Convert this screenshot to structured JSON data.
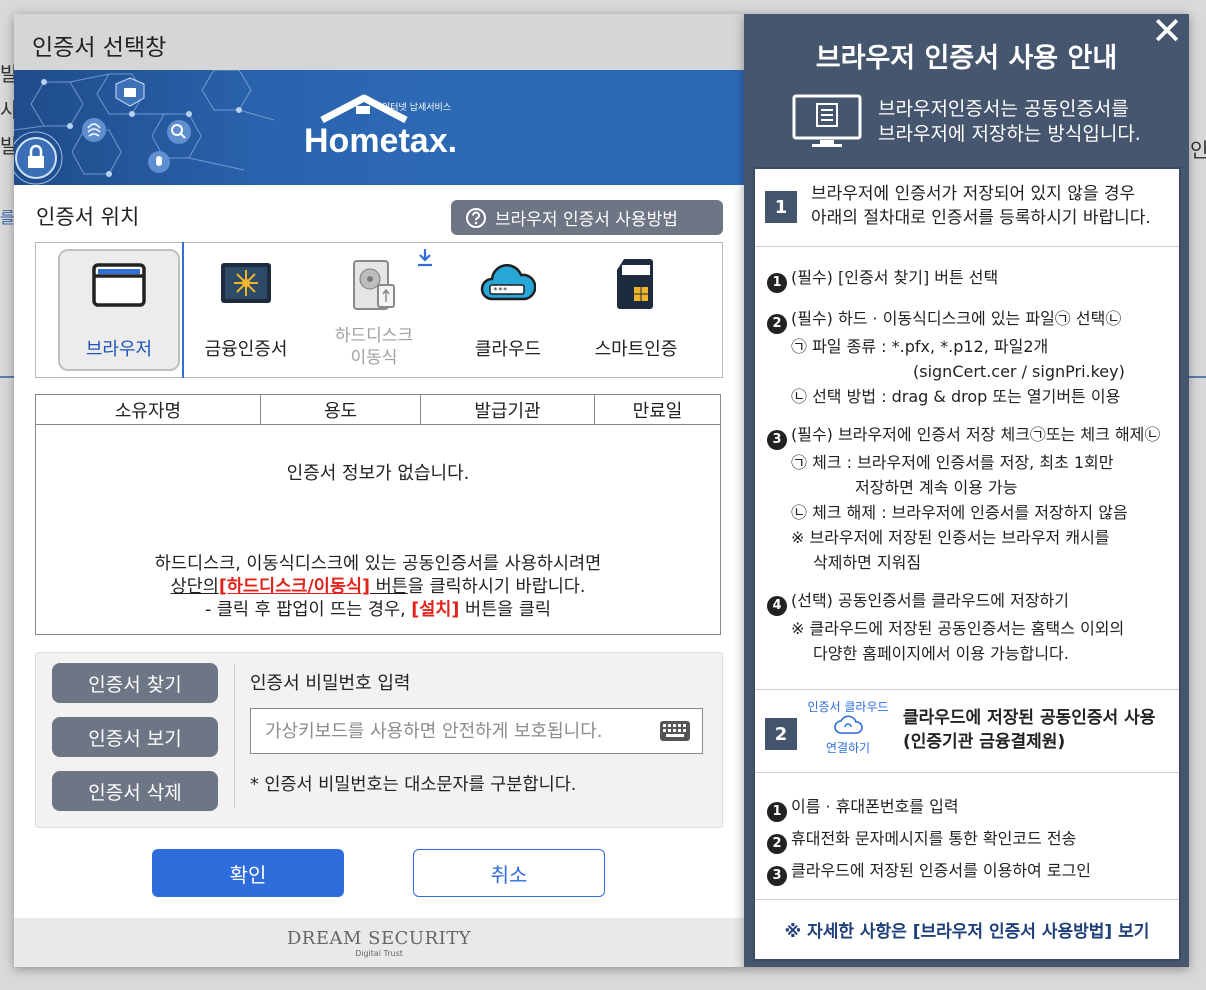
{
  "background": {
    "fragments": [
      "발",
      "사",
      "발",
      "를",
      "인"
    ]
  },
  "dialog": {
    "title": "인증서 선택창",
    "banner": {
      "logo_main": "Hometax.",
      "logo_small": "인터넷 납세서비스"
    },
    "location_label": "인증서 위치",
    "howto_button": "브라우저 인증서 사용방법",
    "locations": [
      {
        "label": "브라우저",
        "icon": "browser-icon",
        "active": true
      },
      {
        "label": "금융인증서",
        "icon": "financial-cert-icon"
      },
      {
        "label_line1": "하드디스크",
        "label_line2": "이동식",
        "icon": "hard-disk-icon",
        "disabled": true
      },
      {
        "label": "클라우드",
        "icon": "cloud-icon"
      },
      {
        "label": "스마트인증",
        "icon": "smart-card-icon"
      }
    ],
    "table": {
      "headers": [
        "소유자명",
        "용도",
        "발급기관",
        "만료일"
      ],
      "empty_message": "인증서 정보가 없습니다.",
      "note_line1": "하드디스크, 이동식디스크에 있는 공동인증서를 사용하시려면",
      "note_line2_a": "상단의",
      "note_line2_b": "[하드디스크/이동식]",
      "note_line2_c": " 버튼",
      "note_line2_d": "을 클릭하시기 바랍니다.",
      "note_line3_a": "- 클릭 후 팝업이 뜨는 경우, ",
      "note_line3_b": "[설치]",
      "note_line3_c": " 버튼을 클릭"
    },
    "side_buttons": [
      "인증서 찾기",
      "인증서 보기",
      "인증서 삭제"
    ],
    "password": {
      "label": "인증서 비밀번호 입력",
      "placeholder": "가상키보드를 사용하면 안전하게 보호됩니다.",
      "value": "",
      "note": "* 인증서 비밀번호는 대소문자를 구분합니다."
    },
    "ok_button": "확인",
    "cancel_button": "취소",
    "footer": {
      "brand": "DREAM SECURITY",
      "tagline": "Digital Trust"
    }
  },
  "guide": {
    "close": "✕",
    "title": "브라우저 인증서 사용 안내",
    "subtitle_line1": "브라우저인증서는 공동인증서를",
    "subtitle_line2": "브라우저에 저장하는 방식입니다.",
    "step1": {
      "number": "1",
      "line1": "브라우저에 인증서가 저장되어 있지 않을 경우",
      "line2": "아래의 절차대로 인증서를 등록하시기 바랍니다.",
      "items": [
        {
          "num": "1",
          "text": "(필수) [인증서 찾기] 버튼 선택"
        },
        {
          "num": "2",
          "text": "(필수) 하드 · 이동식디스크에 있는 파일㉠ 선택㉡"
        },
        {
          "text": "㉠ 파일 종류 : *.pfx,  *.p12, 파일2개"
        },
        {
          "text": "(signCert.cer / signPri.key)"
        },
        {
          "text": "㉡ 선택 방법 : drag & drop 또는 열기버튼 이용"
        },
        {
          "num": "3",
          "text": "(필수) 브라우저에 인증서 저장 체크㉠또는 체크 해제㉡"
        },
        {
          "text": "㉠ 체크 : 브라우저에 인증서를 저장, 최초 1회만"
        },
        {
          "text": "저장하면 계속 이용 가능"
        },
        {
          "text": "㉡ 체크 해제 : 브라우저에 인증서를 저장하지 않음"
        },
        {
          "text": "※ 브라우저에 저장된 인증서는 브라우저 캐시를"
        },
        {
          "text": "삭제하면 지워짐"
        },
        {
          "num": "4",
          "text": "(선택) 공동인증서를 클라우드에 저장하기"
        },
        {
          "text": "※ 클라우드에 저장된 공동인증서는 홈택스 이외의"
        },
        {
          "text": "다양한 홈페이지에서 이용 가능합니다."
        }
      ]
    },
    "step2": {
      "number": "2",
      "cloud_label_top": "인증서 클라우드",
      "cloud_label_bottom": "연결하기",
      "line1": "클라우드에 저장된 공동인증서 사용",
      "line2": "(인증기관 금융결제원)",
      "items": [
        {
          "num": "1",
          "text": "이름 · 휴대폰번호를 입력"
        },
        {
          "num": "2",
          "text": "휴대전화 문자메시지를 통한 확인코드 전송"
        },
        {
          "num": "3",
          "text": "클라우드에 저장된 인증서를 이용하여 로그인"
        }
      ]
    },
    "footer_link": "※ 자세한 사항은 [브라우저 인증서 사용방법] 보기"
  }
}
